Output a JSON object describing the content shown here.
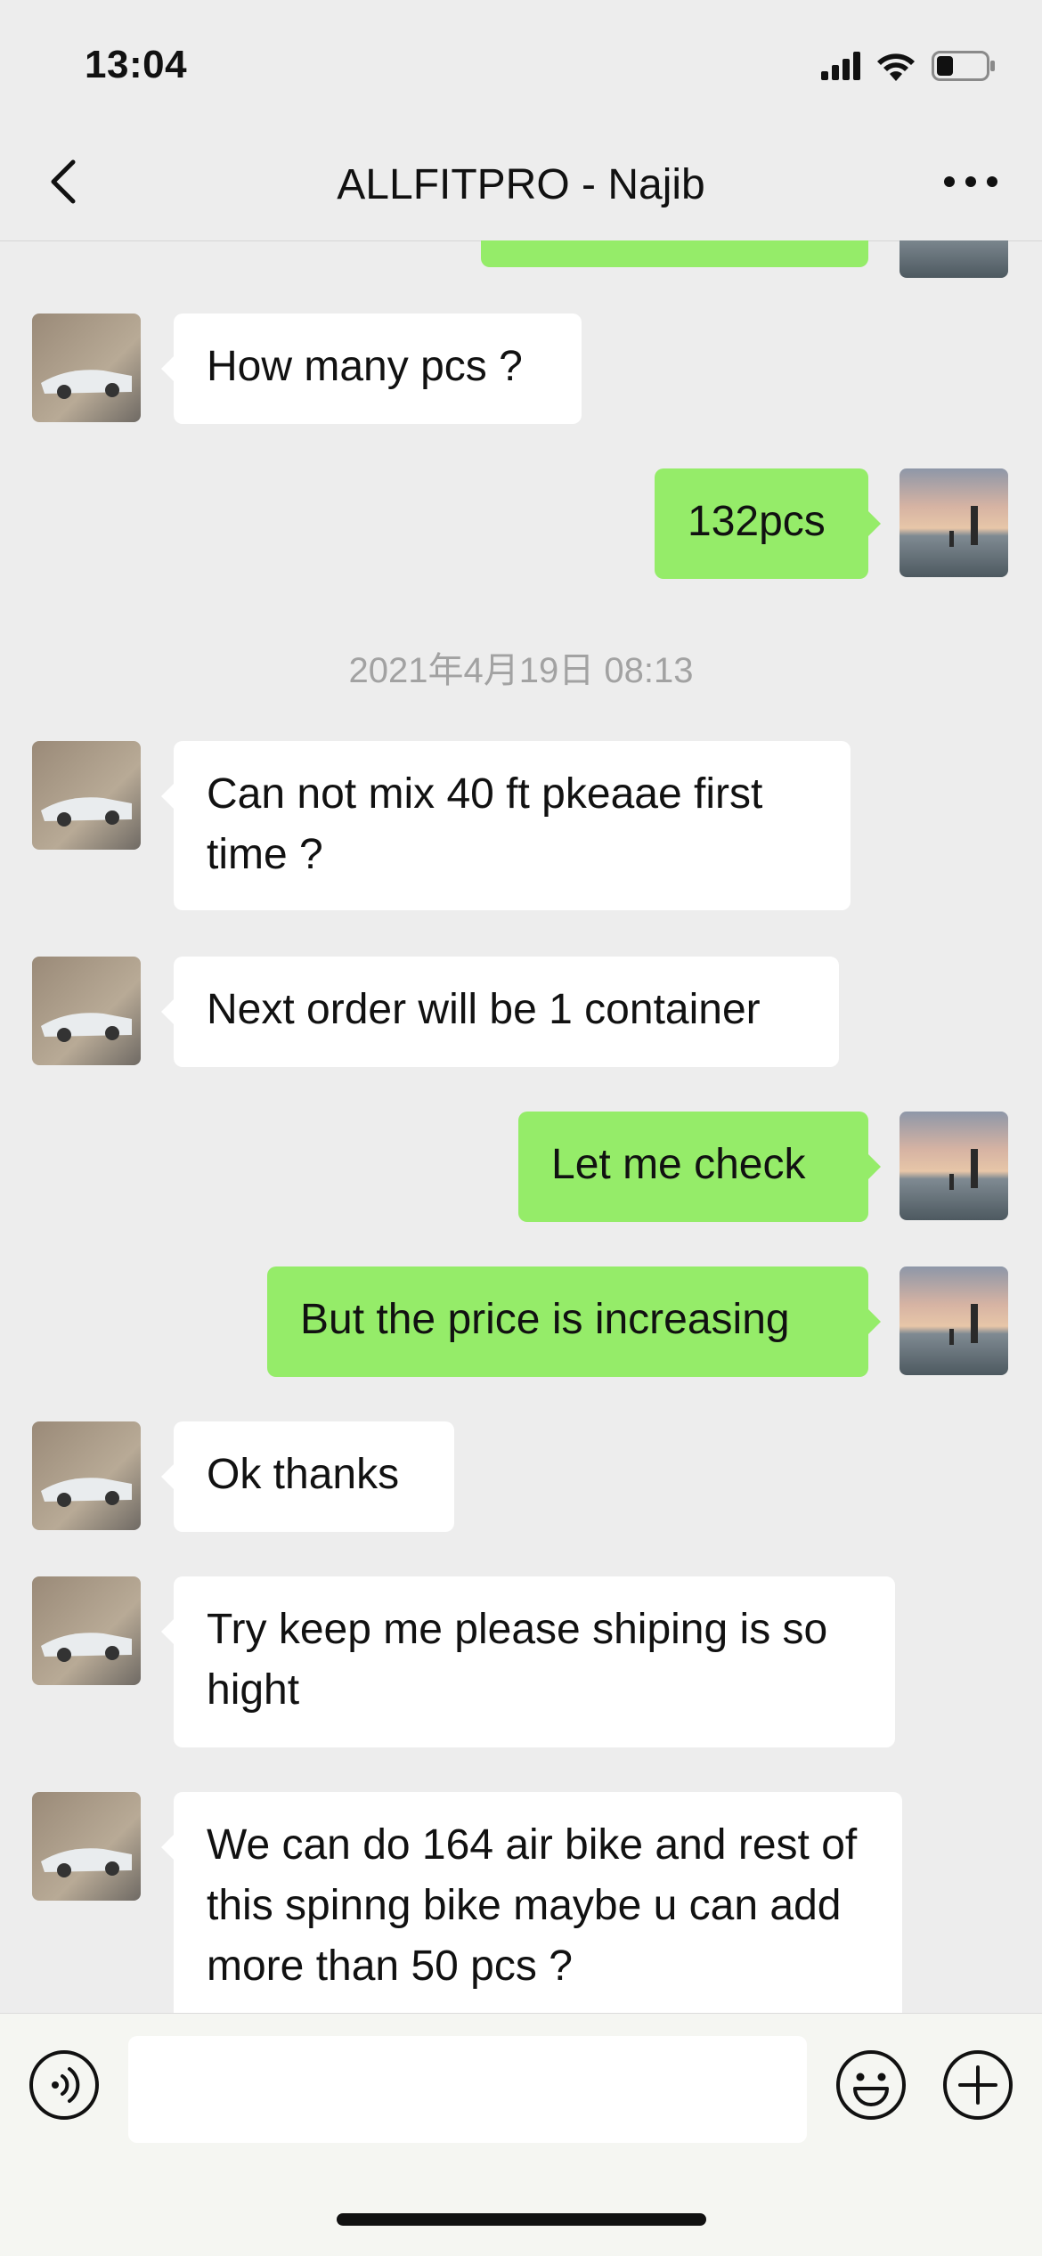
{
  "status_bar": {
    "time": "13:04",
    "icons": [
      "cellular-signal-icon",
      "wifi-icon",
      "battery-icon"
    ]
  },
  "nav": {
    "title": "ALLFITPRO -  Najib",
    "back_icon": "chevron-left-icon",
    "more_icon": "ellipsis-icon"
  },
  "chat": {
    "timestamp": "2021年4月19日 08:13",
    "messages": [
      {
        "side": "in",
        "text": "How many pcs ?"
      },
      {
        "side": "out",
        "text": "132pcs"
      },
      {
        "side": "in",
        "text": "Can not mix 40 ft pkeaae first time ?"
      },
      {
        "side": "in",
        "text": "Next order will be 1 container"
      },
      {
        "side": "out",
        "text": "Let me check"
      },
      {
        "side": "out",
        "text": "But the price is increasing"
      },
      {
        "side": "in",
        "text": "Ok thanks"
      },
      {
        "side": "in",
        "text": "Try keep me please shiping is so hight"
      },
      {
        "side": "in",
        "text": "We can do 164 air bike and rest of this spinng bike  maybe u can add more than 50 pcs ?"
      }
    ]
  },
  "input_bar": {
    "voice_icon": "voice-icon",
    "emoji_icon": "emoji-icon",
    "plus_icon": "plus-icon",
    "value": ""
  },
  "colors": {
    "background": "#ededed",
    "outgoing_bubble": "#95ec69",
    "incoming_bubble": "#ffffff",
    "timestamp_text": "#a2a2a2"
  }
}
